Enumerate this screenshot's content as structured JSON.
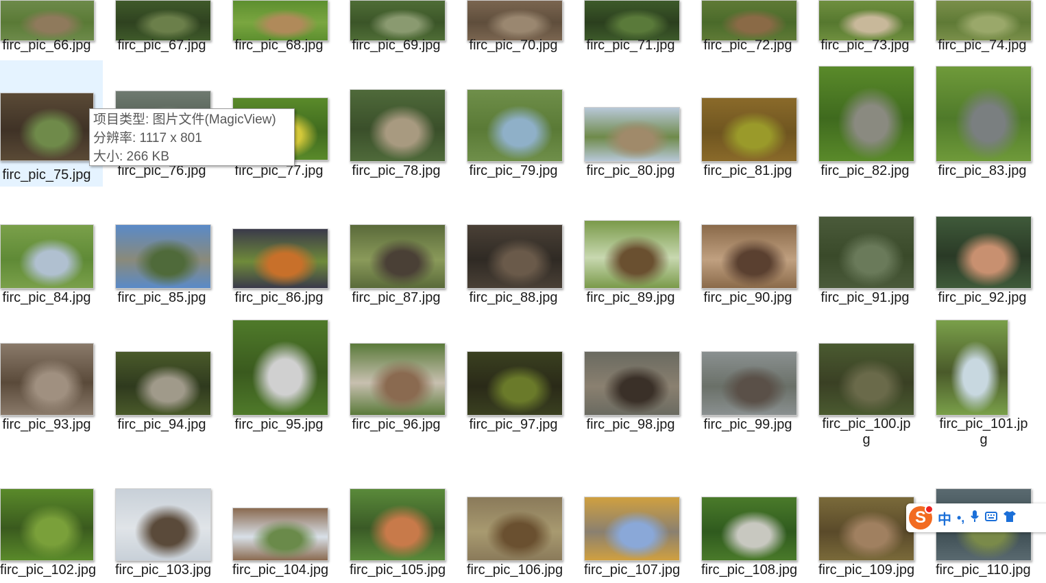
{
  "files": [
    {
      "name": "firc_pic_66.jpg",
      "colors": [
        "#6d8a4a",
        "#8f7a5c",
        "#5a7a36"
      ]
    },
    {
      "name": "firc_pic_67.jpg",
      "colors": [
        "#3f5a2a",
        "#6b7f4a",
        "#2f4220"
      ]
    },
    {
      "name": "firc_pic_68.jpg",
      "colors": [
        "#5d8f2f",
        "#b08a5a",
        "#7aa640"
      ]
    },
    {
      "name": "firc_pic_69.jpg",
      "colors": [
        "#4f6d36",
        "#8a9a70",
        "#3b5528"
      ]
    },
    {
      "name": "firc_pic_70.jpg",
      "colors": [
        "#7a6550",
        "#9a8770",
        "#5f4e3c"
      ]
    },
    {
      "name": "firc_pic_71.jpg",
      "colors": [
        "#3d5a2a",
        "#5a7a3a",
        "#2b3f1e"
      ]
    },
    {
      "name": "firc_pic_72.jpg",
      "colors": [
        "#5f7a36",
        "#8a6a46",
        "#4a6a2a"
      ]
    },
    {
      "name": "firc_pic_73.jpg",
      "colors": [
        "#6f8f3f",
        "#c8b89a",
        "#56782f"
      ]
    },
    {
      "name": "firc_pic_74.jpg",
      "colors": [
        "#7a8f4a",
        "#9aa86a",
        "#5f7a36"
      ]
    },
    {
      "name": "firc_pic_75.jpg",
      "colors": [
        "#5a4a36",
        "#6f8a4a",
        "#3f3226"
      ]
    },
    {
      "name": "firc_pic_76.jpg",
      "colors": [
        "#6f7a70",
        "#8a9a8a",
        "#4f5a50"
      ]
    },
    {
      "name": "firc_pic_77.jpg",
      "colors": [
        "#5a8a2a",
        "#d4c83a",
        "#3f6a1e"
      ]
    },
    {
      "name": "firc_pic_78.jpg",
      "colors": [
        "#4f6a3a",
        "#a89a80",
        "#3a4f2a"
      ]
    },
    {
      "name": "firc_pic_79.jpg",
      "colors": [
        "#6f8f4a",
        "#8fb0c8",
        "#5a7a36"
      ]
    },
    {
      "name": "firc_pic_80.jpg",
      "colors": [
        "#b8c8d8",
        "#a08a6a",
        "#6f8a4a"
      ]
    },
    {
      "name": "firc_pic_81.jpg",
      "colors": [
        "#8a6a2a",
        "#9a9a2a",
        "#6f5520"
      ]
    },
    {
      "name": "firc_pic_82.jpg",
      "colors": [
        "#5a8a2a",
        "#8a8a80",
        "#3f6a1e"
      ]
    },
    {
      "name": "firc_pic_83.jpg",
      "colors": [
        "#6f9a3a",
        "#7a7f80",
        "#4f7a2a"
      ]
    },
    {
      "name": "firc_pic_84.jpg",
      "colors": [
        "#7aa04a",
        "#b0c0d0",
        "#5f8a36"
      ]
    },
    {
      "name": "firc_pic_85.jpg",
      "colors": [
        "#5a8ac8",
        "#4f6a3a",
        "#8a8a7a"
      ]
    },
    {
      "name": "firc_pic_86.jpg",
      "colors": [
        "#3a3a4a",
        "#c8702a",
        "#6f8a3a"
      ]
    },
    {
      "name": "firc_pic_87.jpg",
      "colors": [
        "#5a6a3a",
        "#4a4036",
        "#8a9a5a"
      ]
    },
    {
      "name": "firc_pic_88.jpg",
      "colors": [
        "#4a4036",
        "#6a5a4a",
        "#2f2a24"
      ]
    },
    {
      "name": "firc_pic_89.jpg",
      "colors": [
        "#7a9a4a",
        "#6a5030",
        "#c8d8b0"
      ]
    },
    {
      "name": "firc_pic_90.jpg",
      "colors": [
        "#8a6a4a",
        "#5a4030",
        "#c0a080"
      ]
    },
    {
      "name": "firc_pic_91.jpg",
      "colors": [
        "#4a5a3a",
        "#6a7a5a",
        "#3a4a2a"
      ]
    },
    {
      "name": "firc_pic_92.jpg",
      "colors": [
        "#3f5a3a",
        "#c89070",
        "#2a3a26"
      ]
    },
    {
      "name": "firc_pic_93.jpg",
      "colors": [
        "#8a7a6a",
        "#a09080",
        "#5a4a3a"
      ]
    },
    {
      "name": "firc_pic_94.jpg",
      "colors": [
        "#4a5a2a",
        "#a09a8a",
        "#2f3a1e"
      ]
    },
    {
      "name": "firc_pic_95.jpg",
      "colors": [
        "#4f7a2a",
        "#d0d0d0",
        "#3a5a1e"
      ]
    },
    {
      "name": "firc_pic_96.jpg",
      "colors": [
        "#5a7a3a",
        "#8a6a50",
        "#c8c0b0"
      ]
    },
    {
      "name": "firc_pic_97.jpg",
      "colors": [
        "#3a4020",
        "#6a7a2a",
        "#2a2a18"
      ]
    },
    {
      "name": "firc_pic_98.jpg",
      "colors": [
        "#6a6a60",
        "#3a3028",
        "#8a8070"
      ]
    },
    {
      "name": "firc_pic_99.jpg",
      "colors": [
        "#8a9090",
        "#5a5048",
        "#6a7068"
      ]
    },
    {
      "name": "firc_pic_100.jpg",
      "colors": [
        "#4a5a30",
        "#6a6a4a",
        "#3a4024"
      ]
    },
    {
      "name": "firc_pic_101.jpg",
      "colors": [
        "#7aa04a",
        "#c8d8e0",
        "#4a5a2a"
      ]
    },
    {
      "name": "firc_pic_102.jpg",
      "colors": [
        "#5a8a2a",
        "#7aa03a",
        "#3a5a1e"
      ]
    },
    {
      "name": "firc_pic_103.jpg",
      "colors": [
        "#c8d0d8",
        "#5a4a3a",
        "#e0e4e8"
      ]
    },
    {
      "name": "firc_pic_104.jpg",
      "colors": [
        "#8a6a50",
        "#6a8a4a",
        "#d8e0e8"
      ]
    },
    {
      "name": "firc_pic_105.jpg",
      "colors": [
        "#5a8a3a",
        "#c87a4a",
        "#3a5a26"
      ]
    },
    {
      "name": "firc_pic_106.jpg",
      "colors": [
        "#8a7a5a",
        "#6a5030",
        "#a89a70"
      ]
    },
    {
      "name": "firc_pic_107.jpg",
      "colors": [
        "#d0a040",
        "#8aa8d8",
        "#8a8070"
      ]
    },
    {
      "name": "firc_pic_108.jpg",
      "colors": [
        "#4a7a2a",
        "#c8c8c0",
        "#2f5a1e"
      ]
    },
    {
      "name": "firc_pic_109.jpg",
      "colors": [
        "#7a6a3a",
        "#a08060",
        "#5a4a2a"
      ]
    },
    {
      "name": "firc_pic_110.jpg",
      "colors": [
        "#5a6a70",
        "#7a8a4a",
        "#3a4a50"
      ]
    }
  ],
  "tooltip": {
    "type": "项目类型: 图片文件(MagicView)",
    "resolution": "分辨率: 1117 x 801",
    "size": "大小: 266 KB"
  },
  "ime": {
    "cn_label": "中",
    "punct": "•,",
    "mic_icon": "microphone-icon",
    "keyboard_icon": "keyboard-icon",
    "skin_icon": "shirt-icon"
  },
  "accent": "#e5f3ff"
}
